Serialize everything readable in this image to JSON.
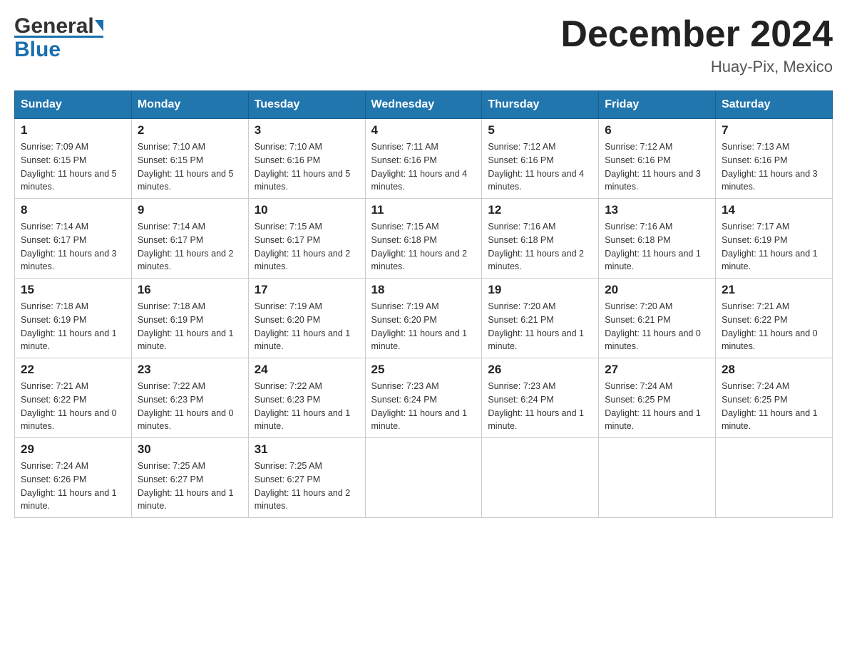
{
  "header": {
    "logo_line1": "General",
    "logo_line2": "Blue",
    "month": "December 2024",
    "location": "Huay-Pix, Mexico"
  },
  "weekdays": [
    "Sunday",
    "Monday",
    "Tuesday",
    "Wednesday",
    "Thursday",
    "Friday",
    "Saturday"
  ],
  "weeks": [
    [
      {
        "day": "1",
        "sunrise": "7:09 AM",
        "sunset": "6:15 PM",
        "daylight": "11 hours and 5 minutes."
      },
      {
        "day": "2",
        "sunrise": "7:10 AM",
        "sunset": "6:15 PM",
        "daylight": "11 hours and 5 minutes."
      },
      {
        "day": "3",
        "sunrise": "7:10 AM",
        "sunset": "6:16 PM",
        "daylight": "11 hours and 5 minutes."
      },
      {
        "day": "4",
        "sunrise": "7:11 AM",
        "sunset": "6:16 PM",
        "daylight": "11 hours and 4 minutes."
      },
      {
        "day": "5",
        "sunrise": "7:12 AM",
        "sunset": "6:16 PM",
        "daylight": "11 hours and 4 minutes."
      },
      {
        "day": "6",
        "sunrise": "7:12 AM",
        "sunset": "6:16 PM",
        "daylight": "11 hours and 3 minutes."
      },
      {
        "day": "7",
        "sunrise": "7:13 AM",
        "sunset": "6:16 PM",
        "daylight": "11 hours and 3 minutes."
      }
    ],
    [
      {
        "day": "8",
        "sunrise": "7:14 AM",
        "sunset": "6:17 PM",
        "daylight": "11 hours and 3 minutes."
      },
      {
        "day": "9",
        "sunrise": "7:14 AM",
        "sunset": "6:17 PM",
        "daylight": "11 hours and 2 minutes."
      },
      {
        "day": "10",
        "sunrise": "7:15 AM",
        "sunset": "6:17 PM",
        "daylight": "11 hours and 2 minutes."
      },
      {
        "day": "11",
        "sunrise": "7:15 AM",
        "sunset": "6:18 PM",
        "daylight": "11 hours and 2 minutes."
      },
      {
        "day": "12",
        "sunrise": "7:16 AM",
        "sunset": "6:18 PM",
        "daylight": "11 hours and 2 minutes."
      },
      {
        "day": "13",
        "sunrise": "7:16 AM",
        "sunset": "6:18 PM",
        "daylight": "11 hours and 1 minute."
      },
      {
        "day": "14",
        "sunrise": "7:17 AM",
        "sunset": "6:19 PM",
        "daylight": "11 hours and 1 minute."
      }
    ],
    [
      {
        "day": "15",
        "sunrise": "7:18 AM",
        "sunset": "6:19 PM",
        "daylight": "11 hours and 1 minute."
      },
      {
        "day": "16",
        "sunrise": "7:18 AM",
        "sunset": "6:19 PM",
        "daylight": "11 hours and 1 minute."
      },
      {
        "day": "17",
        "sunrise": "7:19 AM",
        "sunset": "6:20 PM",
        "daylight": "11 hours and 1 minute."
      },
      {
        "day": "18",
        "sunrise": "7:19 AM",
        "sunset": "6:20 PM",
        "daylight": "11 hours and 1 minute."
      },
      {
        "day": "19",
        "sunrise": "7:20 AM",
        "sunset": "6:21 PM",
        "daylight": "11 hours and 1 minute."
      },
      {
        "day": "20",
        "sunrise": "7:20 AM",
        "sunset": "6:21 PM",
        "daylight": "11 hours and 0 minutes."
      },
      {
        "day": "21",
        "sunrise": "7:21 AM",
        "sunset": "6:22 PM",
        "daylight": "11 hours and 0 minutes."
      }
    ],
    [
      {
        "day": "22",
        "sunrise": "7:21 AM",
        "sunset": "6:22 PM",
        "daylight": "11 hours and 0 minutes."
      },
      {
        "day": "23",
        "sunrise": "7:22 AM",
        "sunset": "6:23 PM",
        "daylight": "11 hours and 0 minutes."
      },
      {
        "day": "24",
        "sunrise": "7:22 AM",
        "sunset": "6:23 PM",
        "daylight": "11 hours and 1 minute."
      },
      {
        "day": "25",
        "sunrise": "7:23 AM",
        "sunset": "6:24 PM",
        "daylight": "11 hours and 1 minute."
      },
      {
        "day": "26",
        "sunrise": "7:23 AM",
        "sunset": "6:24 PM",
        "daylight": "11 hours and 1 minute."
      },
      {
        "day": "27",
        "sunrise": "7:24 AM",
        "sunset": "6:25 PM",
        "daylight": "11 hours and 1 minute."
      },
      {
        "day": "28",
        "sunrise": "7:24 AM",
        "sunset": "6:25 PM",
        "daylight": "11 hours and 1 minute."
      }
    ],
    [
      {
        "day": "29",
        "sunrise": "7:24 AM",
        "sunset": "6:26 PM",
        "daylight": "11 hours and 1 minute."
      },
      {
        "day": "30",
        "sunrise": "7:25 AM",
        "sunset": "6:27 PM",
        "daylight": "11 hours and 1 minute."
      },
      {
        "day": "31",
        "sunrise": "7:25 AM",
        "sunset": "6:27 PM",
        "daylight": "11 hours and 2 minutes."
      },
      null,
      null,
      null,
      null
    ]
  ],
  "labels": {
    "sunrise": "Sunrise:",
    "sunset": "Sunset:",
    "daylight": "Daylight:"
  }
}
